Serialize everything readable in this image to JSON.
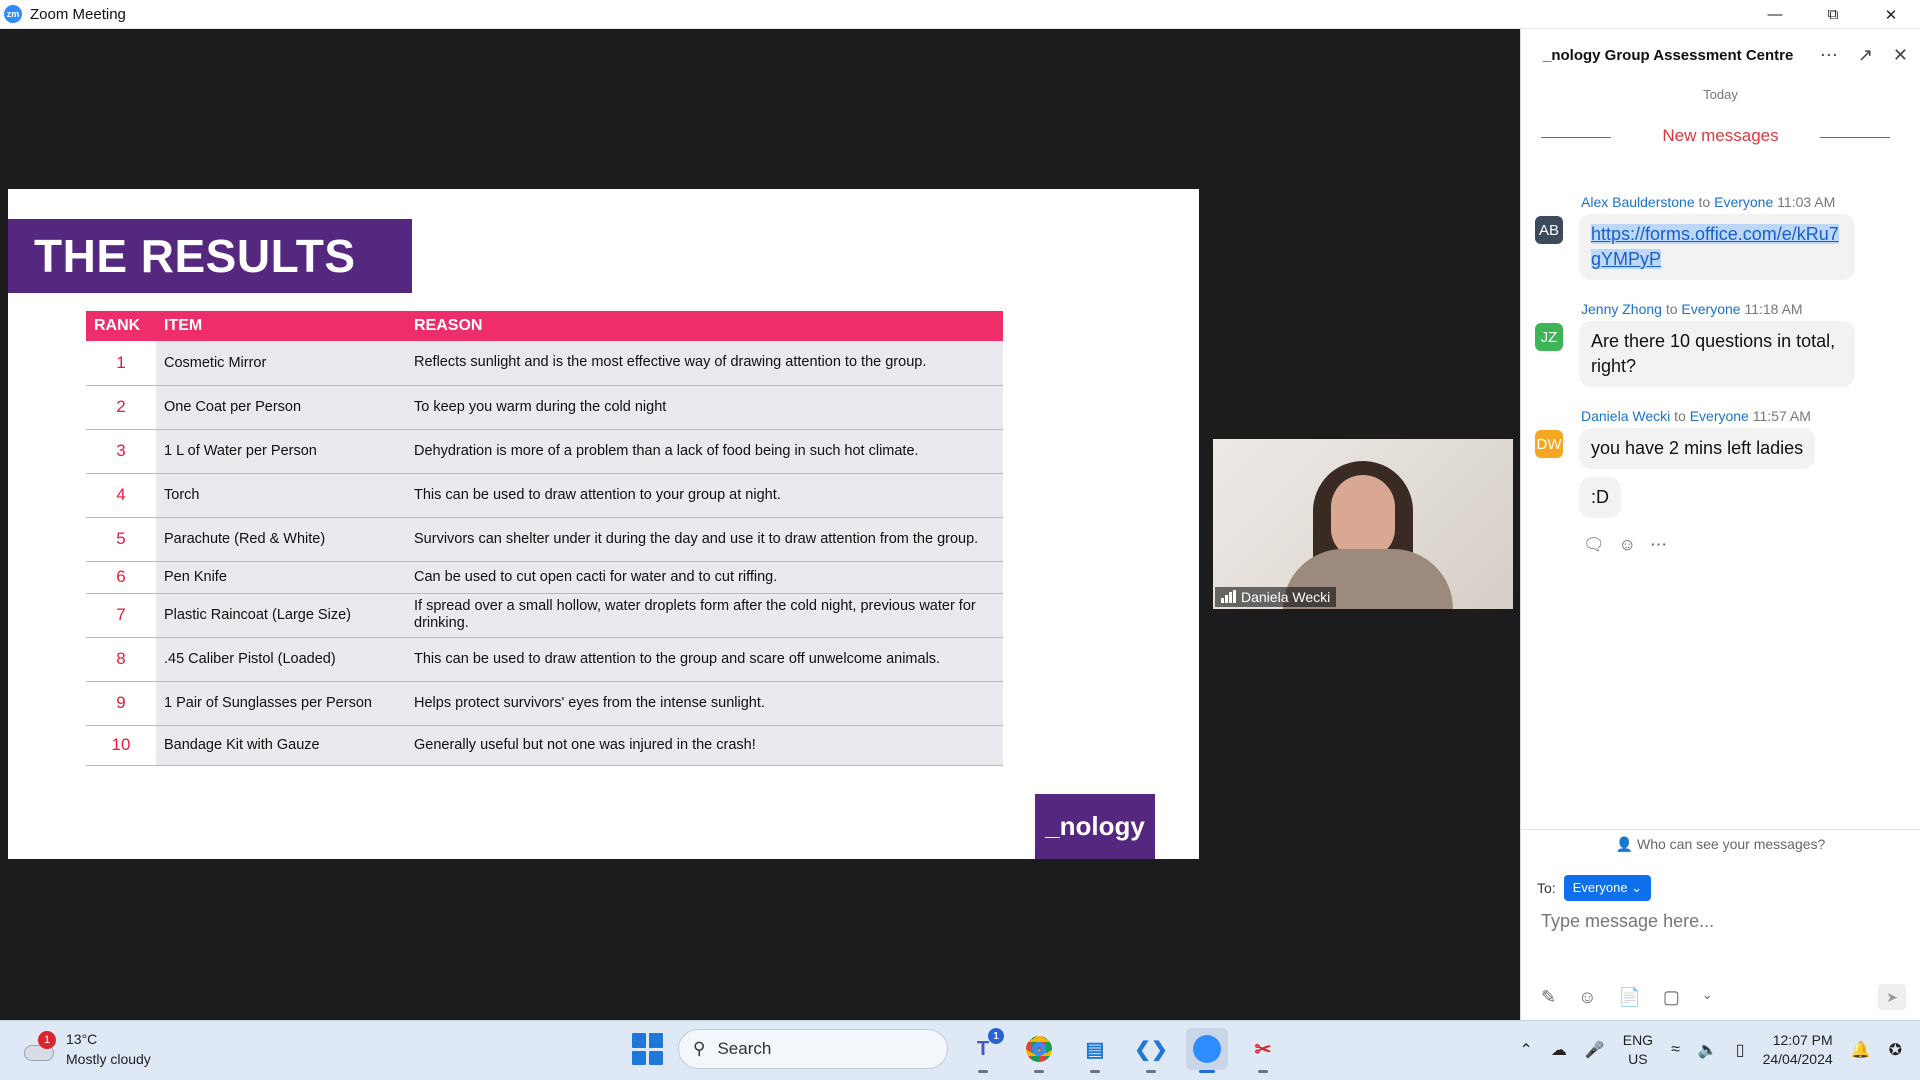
{
  "window": {
    "title": "Zoom Meeting",
    "app_icon": "zm"
  },
  "slide": {
    "heading": "THE RESULTS",
    "columns": [
      "RANK",
      "ITEM",
      "REASON"
    ],
    "rows": [
      {
        "rank": "1",
        "item": "Cosmetic Mirror",
        "reason": "Reflects sunlight and is the most effective way of drawing attention to the group."
      },
      {
        "rank": "2",
        "item": "One Coat per Person",
        "reason": "To keep you warm during the cold night"
      },
      {
        "rank": "3",
        "item": "1 L of Water per Person",
        "reason": "Dehydration is more of a problem than a lack of food being in such hot climate."
      },
      {
        "rank": "4",
        "item": "Torch",
        "reason": "This can be used to draw attention to your group at night."
      },
      {
        "rank": "5",
        "item": "Parachute (Red & White)",
        "reason": "Survivors can shelter under it during the day and use it to draw attention from the group."
      },
      {
        "rank": "6",
        "item": "Pen Knife",
        "reason": "Can be used to cut open cacti for water and to cut riffing."
      },
      {
        "rank": "7",
        "item": "Plastic Raincoat (Large Size)",
        "reason": "If spread over a small hollow, water droplets form after the cold night, previous water for drinking."
      },
      {
        "rank": "8",
        "item": ".45 Caliber Pistol (Loaded)",
        "reason": "This can be used to draw attention to the group and scare off unwelcome animals."
      },
      {
        "rank": "9",
        "item": "1 Pair of Sunglasses per Person",
        "reason": "Helps protect survivors' eyes from the intense sunlight."
      },
      {
        "rank": "10",
        "item": "Bandage Kit with Gauze",
        "reason": "Generally useful but not one was injured in the crash!"
      }
    ],
    "logo": "_nology"
  },
  "video": {
    "participant_name": "Daniela Wecki"
  },
  "chat": {
    "title": "_nology Group Assessment Centre",
    "day_label": "Today",
    "new_messages_label": "New messages",
    "messages": [
      {
        "initials": "AB",
        "sender": "Alex Baulderstone",
        "to_word": "to",
        "recipient": "Everyone",
        "time": "11:03 AM",
        "text": "https://forms.office.com/e/kRu7gYMPyP",
        "avatar_color": "#3c4a5c"
      },
      {
        "initials": "JZ",
        "sender": "Jenny Zhong",
        "to_word": "to",
        "recipient": "Everyone",
        "time": "11:18 AM",
        "text": "Are there 10 questions in total, right?",
        "avatar_color": "#3db556"
      },
      {
        "initials": "DW",
        "sender": "Daniela Wecki",
        "to_word": "to",
        "recipient": "Everyone",
        "time": "11:57 AM",
        "text": "you have 2 mins left ladies",
        "text2": ":D",
        "avatar_color": "#f5a623"
      }
    ],
    "who_can_see": "Who can see your messages?",
    "to_label": "To:",
    "to_value": "Everyone",
    "input_placeholder": "Type message here..."
  },
  "taskbar": {
    "weather_badge": "1",
    "temperature": "13°C",
    "condition": "Mostly cloudy",
    "search_label": "Search",
    "teams_badge": "1",
    "lang_top": "ENG",
    "lang_bottom": "US",
    "time": "12:07 PM",
    "date": "24/04/2024"
  },
  "colors": {
    "slide_purple": "#55287f",
    "table_header_pink": "#ee2e6a",
    "rank_red": "#e01e3c",
    "zoom_blue": "#0e71eb"
  }
}
